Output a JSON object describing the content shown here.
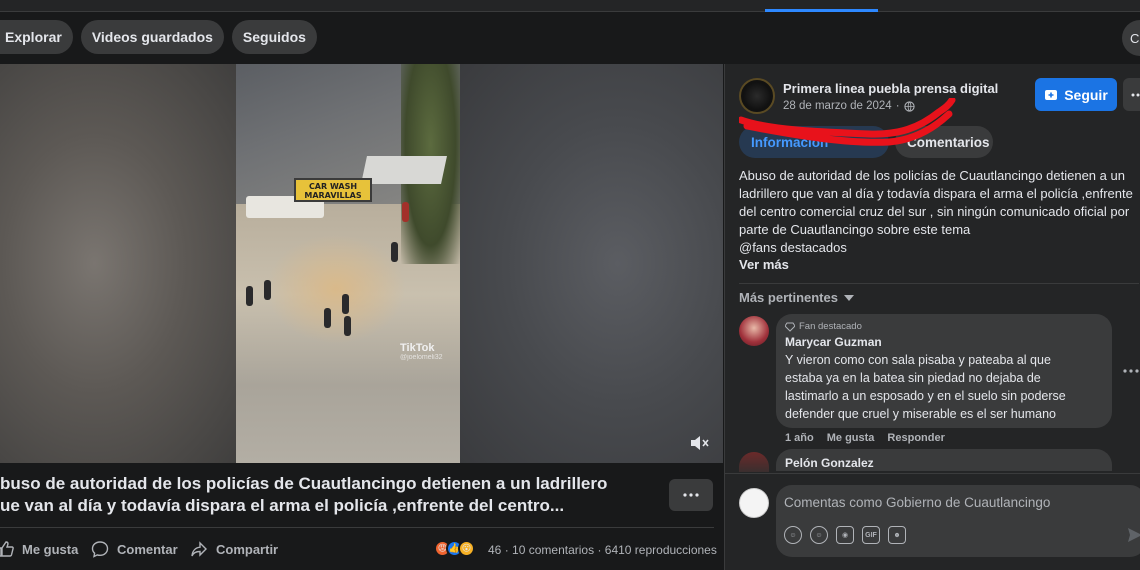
{
  "nav": {
    "chips": [
      "Explorar",
      "Videos guardados",
      "Seguidos"
    ],
    "right_button_glyph": "C"
  },
  "video": {
    "sign_text": "CAR WASH MARAVILLAS",
    "watermark_brand": "TikTok",
    "watermark_handle": "@joelomeli32",
    "mute_icon": "speaker-muted-icon"
  },
  "post": {
    "title_line1": "buso de autoridad de los policías de Cuautlancingo detienen a un ladrillero",
    "title_line2": "ue van al día y todavía dispara el arma el policía ,enfrente del centro...",
    "actions": {
      "like": "Me gusta",
      "comment": "Comentar",
      "share": "Compartir"
    },
    "reaction_count": "46",
    "comments_count": "10 comentarios",
    "views": "6410 reproducciones",
    "separator": "·"
  },
  "sidebar": {
    "page_name": "Primera linea puebla prensa digital",
    "date": "28 de marzo de 2024",
    "date_separator": "·",
    "follow_label": "Seguir",
    "tabs": [
      "Información",
      "Comentarios"
    ],
    "description_lines": [
      "Abuso de autoridad de los policías de Cuautlancingo detienen a un",
      "ladrillero que van al día y todavía dispara el arma el policía ,enfrente",
      "del centro comercial cruz del sur , sin ningún comunicado oficial por",
      "parte de Cuautlancingo sobre este tema",
      "@fans destacados"
    ],
    "see_more": "Ver más",
    "sort_label": "Más pertinentes"
  },
  "comments": [
    {
      "badge": "Fan destacado",
      "author": "Marycar Guzman",
      "lines": [
        "Y vieron como con sala pisaba y pateaba al que",
        "estaba ya en la batea sin piedad no dejaba de",
        "lastimarlo a un esposado y en el suelo sin poderse",
        "defender que cruel y miserable es el ser humano"
      ],
      "time": "1 año",
      "like": "Me gusta",
      "reply": "Responder"
    },
    {
      "author": "Pelón Gonzalez"
    }
  ],
  "composer": {
    "placeholder": "Comentas como Gobierno de Cuautlancingo",
    "tools": [
      "avatar-sticker-icon",
      "emoji-icon",
      "camera-icon",
      "gif-icon",
      "sticker-icon"
    ]
  },
  "colors": {
    "accent": "#1b74e4",
    "annotation_red": "#e8121b",
    "background": "#18191a",
    "panel": "#242526"
  }
}
